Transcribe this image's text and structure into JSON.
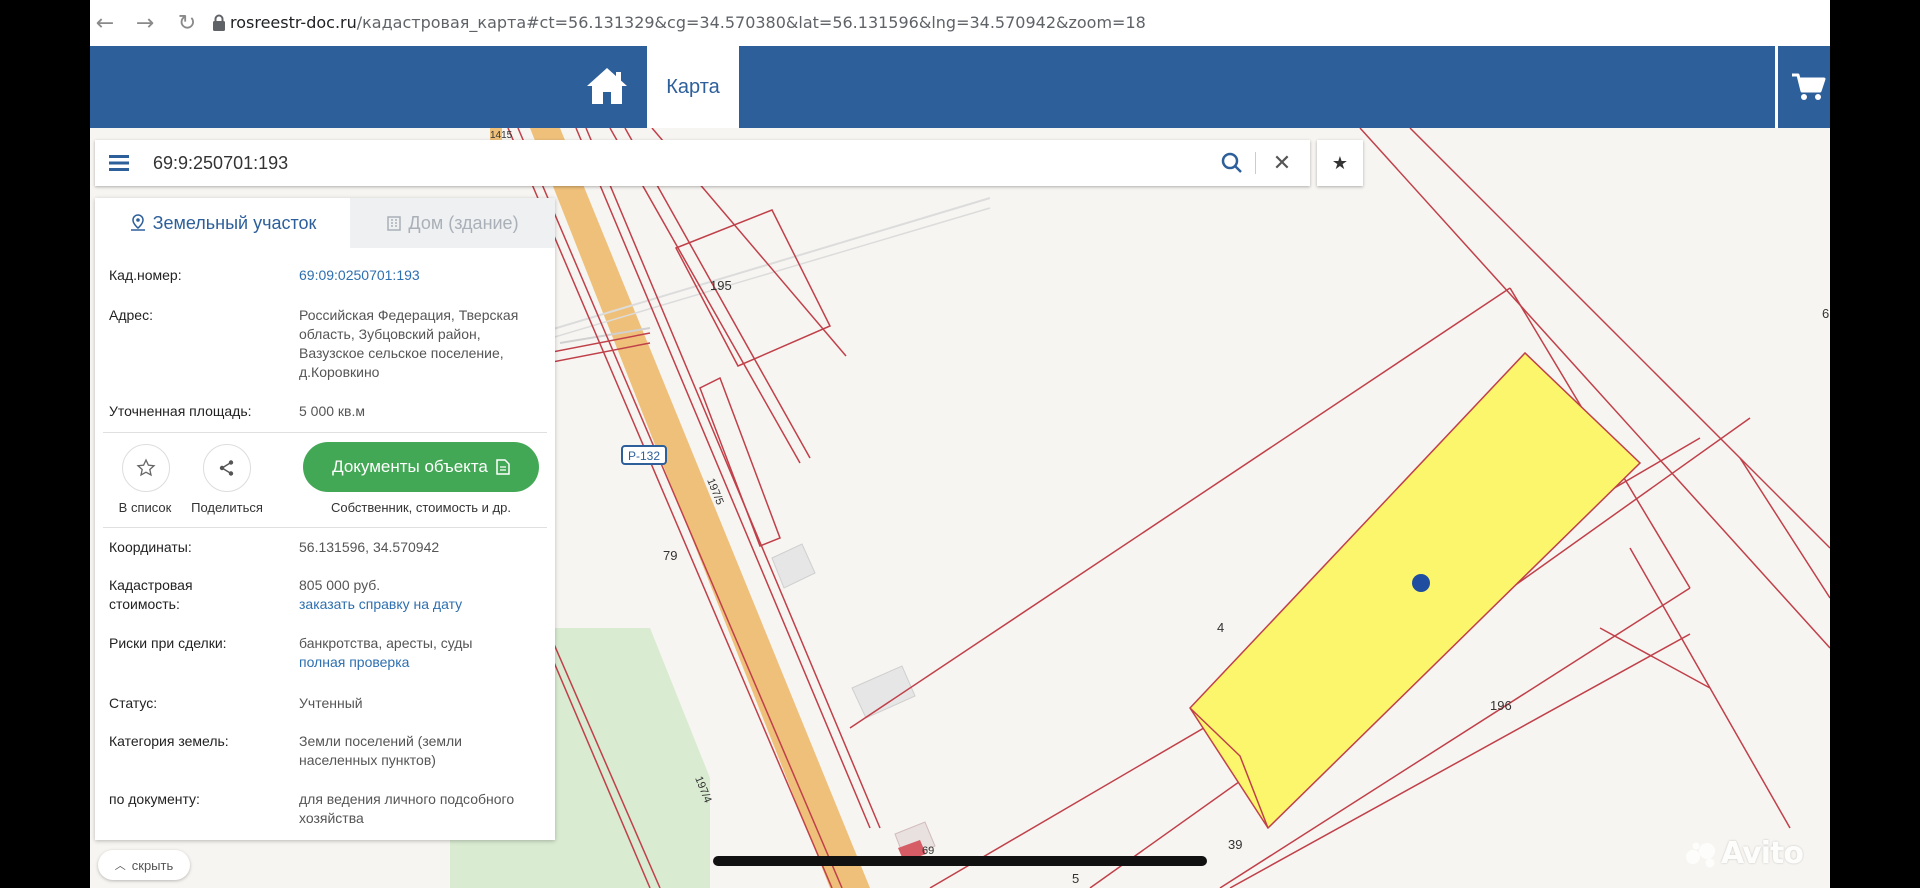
{
  "browser": {
    "url_host": "rosreestr-doc.ru",
    "url_path": "/кадастровая_карта#ct=56.131329&cg=34.570380&lat=56.131596&lng=34.570942&zoom=18"
  },
  "header": {
    "tab_map": "Карта"
  },
  "search": {
    "value": "69:9:250701:193"
  },
  "panel": {
    "tab_land": "Земельный участок",
    "tab_house": "Дом (здание)",
    "cad_label": "Кад.номер:",
    "cad_value": "69:09:0250701:193",
    "address_label": "Адрес:",
    "address_value": "Российская Федерация, Тверская область, Зубцовский район, Вазузское сельское поселение, д.Коровкино",
    "area_label": "Уточненная площадь:",
    "area_value": "5 000 кв.м",
    "action_list": "В список",
    "action_share": "Поделиться",
    "docs_button": "Документы объекта",
    "docs_sub": "Собственник, стоимость и др.",
    "coords_label": "Координаты:",
    "coords_value": "56.131596, 34.570942",
    "cost_label": "Кадастровая стоимость:",
    "cost_value": "805 000 руб.",
    "cost_link": "заказать справку на дату",
    "risk_label": "Риски при сделки:",
    "risk_value": "банкротства, аресты, суды",
    "risk_link": "полная проверка",
    "status_label": "Статус:",
    "status_value": "Учтенный",
    "category_label": "Категория земель:",
    "category_value": "Земли поселений (земли населенных пунктов)",
    "doc_label": "по документу:",
    "doc_value": "для ведения личного подсобного хозяйства"
  },
  "map": {
    "labels": {
      "p195": "195",
      "p79": "79",
      "p4": "4",
      "p196": "196",
      "p39": "39",
      "p5": "5",
      "p69": "69",
      "p6": "6",
      "road": "Р-132",
      "road_top": "1415",
      "r1975": "197/5",
      "r1974": "197/4"
    },
    "colors": {
      "selected_parcel": "#fbf66b",
      "boundary": "#c0404a",
      "road": "#efc07a",
      "green": "#d9ebd1",
      "marker": "#1f4ea0"
    }
  },
  "hide_button": "скрыть",
  "watermark": "Avito"
}
